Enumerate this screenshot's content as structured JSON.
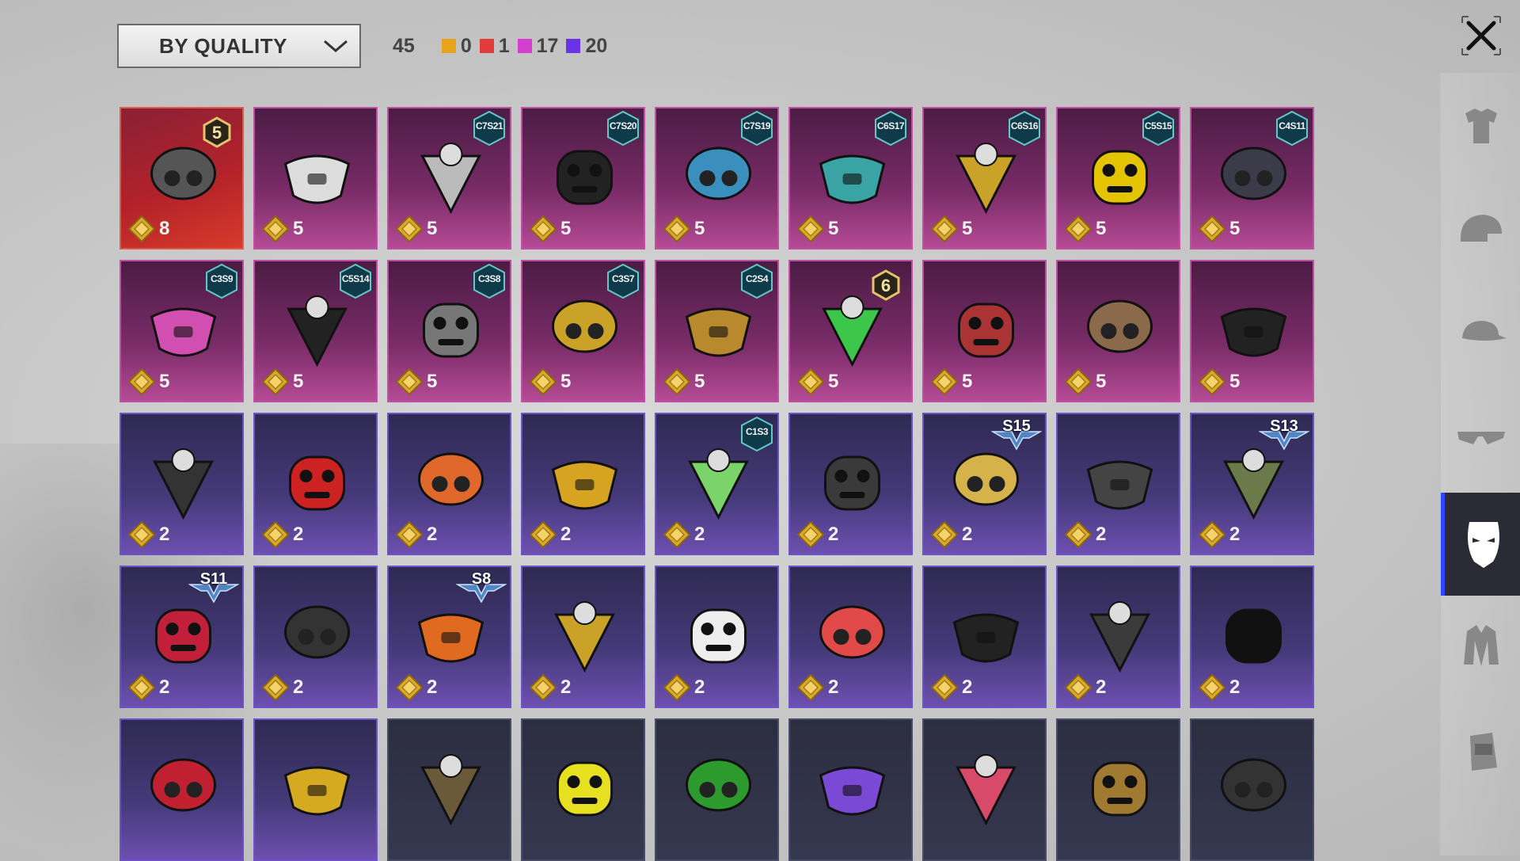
{
  "sort": {
    "label": "BY QUALITY",
    "icon": "chevron-down-icon"
  },
  "counts": {
    "total": "45",
    "groups": [
      {
        "color": "#e8a21c",
        "value": "0"
      },
      {
        "color": "#e23b3b",
        "value": "1"
      },
      {
        "color": "#d43dd0",
        "value": "17"
      },
      {
        "color": "#6a34e6",
        "value": "20"
      }
    ]
  },
  "close_icon": "close-icon",
  "items": [
    {
      "quality": "red",
      "price": "8",
      "rank": "5",
      "art": "gas-mask-red-icon"
    },
    {
      "quality": "pink",
      "price": "5",
      "art": "cat-mask-icon"
    },
    {
      "quality": "pink",
      "price": "5",
      "badge": "C7S21",
      "art": "robot-face-mask-icon"
    },
    {
      "quality": "pink",
      "price": "5",
      "badge": "C7S20",
      "art": "black-teal-mask-icon"
    },
    {
      "quality": "pink",
      "price": "5",
      "badge": "C7S19",
      "art": "blue-yellow-mask-icon"
    },
    {
      "quality": "pink",
      "price": "5",
      "badge": "C6S17",
      "art": "teal-pattern-mask-icon"
    },
    {
      "quality": "pink",
      "price": "5",
      "badge": "C6S16",
      "art": "yellow-gas-mask-icon"
    },
    {
      "quality": "pink",
      "price": "5",
      "badge": "C5S15",
      "art": "yellow-respirator-icon"
    },
    {
      "quality": "pink",
      "price": "5",
      "badge": "C4S11",
      "art": "dark-half-mask-icon"
    },
    {
      "quality": "pink",
      "price": "5",
      "badge": "C3S9",
      "art": "pink-gas-mask-icon"
    },
    {
      "quality": "pink",
      "price": "5",
      "badge": "C5S14",
      "art": "black-star-mask-icon"
    },
    {
      "quality": "pink",
      "price": "5",
      "badge": "C3S8",
      "art": "tactical-respirator-icon"
    },
    {
      "quality": "pink",
      "price": "5",
      "badge": "C3S7",
      "art": "gold-ornate-mask-icon"
    },
    {
      "quality": "pink",
      "price": "5",
      "badge": "C2S4",
      "art": "gold-skull-mask-icon"
    },
    {
      "quality": "pink",
      "price": "5",
      "rank": "6",
      "art": "green-glasses-mask-icon"
    },
    {
      "quality": "pink",
      "price": "5",
      "art": "skull-bandana-red-icon"
    },
    {
      "quality": "pink",
      "price": "5",
      "art": "plague-beak-mask-icon"
    },
    {
      "quality": "pink",
      "price": "5",
      "art": "skull-bandana-black-icon"
    },
    {
      "quality": "purple",
      "price": "2",
      "art": "black-face-mask-icon"
    },
    {
      "quality": "purple",
      "price": "2",
      "art": "red-lens-mask-icon"
    },
    {
      "quality": "purple",
      "price": "2",
      "art": "orange-goggle-strap-icon"
    },
    {
      "quality": "purple",
      "price": "2",
      "art": "teal-goggles-helmet-icon"
    },
    {
      "quality": "purple",
      "price": "2",
      "badge": "C1S3",
      "art": "green-bandana-icon"
    },
    {
      "quality": "purple",
      "price": "2",
      "art": "dark-bandana-icon"
    },
    {
      "quality": "purple",
      "price": "2",
      "season": "S15",
      "art": "gold-skull-helmet-icon"
    },
    {
      "quality": "purple",
      "price": "2",
      "art": "visor-mask-icon"
    },
    {
      "quality": "purple",
      "price": "2",
      "season": "S13",
      "art": "pilot-goggles-mask-icon"
    },
    {
      "quality": "purple",
      "price": "2",
      "season": "S11",
      "art": "red-half-mask-icon"
    },
    {
      "quality": "purple",
      "price": "2",
      "art": "hockey-mask-icon"
    },
    {
      "quality": "purple",
      "price": "2",
      "season": "S8",
      "art": "flame-bandana-icon"
    },
    {
      "quality": "purple",
      "price": "2",
      "art": "gold-studded-mask-icon"
    },
    {
      "quality": "purple",
      "price": "2",
      "art": "white-black-mask-icon"
    },
    {
      "quality": "purple",
      "price": "2",
      "art": "teeth-face-mask-icon"
    },
    {
      "quality": "purple",
      "price": "2",
      "art": "dark-demon-mask-icon"
    },
    {
      "quality": "purple",
      "price": "2",
      "art": "leather-muzzle-icon"
    },
    {
      "quality": "purple",
      "price": "2",
      "art": "black-bandana-icon"
    },
    {
      "quality": "purple",
      "art": "red-ribbon-icon"
    },
    {
      "quality": "purple",
      "art": "gold-glitter-mask-icon"
    },
    {
      "quality": "dark",
      "art": "stitched-sack-mask-icon"
    },
    {
      "quality": "dark",
      "art": "yellow-net-bandana-icon"
    },
    {
      "quality": "dark",
      "art": "web-pattern-bandana-icon"
    },
    {
      "quality": "dark",
      "art": "purple-theater-mask-icon"
    },
    {
      "quality": "dark",
      "art": "pink-theater-mask-icon"
    },
    {
      "quality": "dark",
      "art": "gold-pattern-mask-icon"
    },
    {
      "quality": "dark",
      "art": "dark-gas-mask-icon"
    }
  ],
  "sidebar": [
    {
      "name": "outfit-icon",
      "active": false
    },
    {
      "name": "helmet-icon",
      "active": false
    },
    {
      "name": "cap-icon",
      "active": false
    },
    {
      "name": "glasses-icon",
      "active": false
    },
    {
      "name": "mask-icon",
      "active": true
    },
    {
      "name": "jacket-icon",
      "active": false
    },
    {
      "name": "backpack-icon",
      "active": false
    }
  ]
}
